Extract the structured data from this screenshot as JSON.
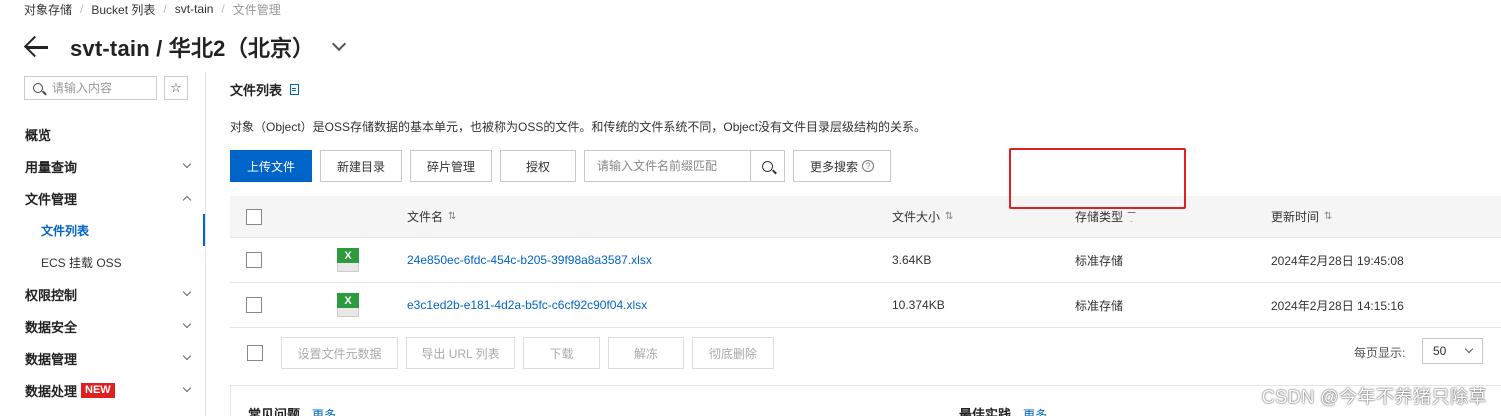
{
  "breadcrumb": [
    "对象存储",
    "Bucket 列表",
    "svt-tain",
    "文件管理"
  ],
  "header": {
    "bucket": "svt-tain",
    "separator": " / ",
    "region": "华北2（北京）"
  },
  "sidebar": {
    "search_placeholder": "请输入内容",
    "star": "☆",
    "items": [
      {
        "label": "概览"
      },
      {
        "label": "用量查询"
      },
      {
        "label": "文件管理"
      },
      {
        "label": "文件列表"
      },
      {
        "label": "ECS 挂载 OSS"
      },
      {
        "label": "权限控制"
      },
      {
        "label": "数据安全"
      },
      {
        "label": "数据管理"
      },
      {
        "label": "数据处理",
        "badge": "NEW"
      }
    ]
  },
  "main": {
    "title": "文件列表",
    "description": "对象（Object）是OSS存储数据的基本单元，也被称为OSS的文件。和传统的文件系统不同，Object没有文件目录层级结构的关系。",
    "toolbar": {
      "upload": "上传文件",
      "new_dir": "新建目录",
      "fragments": "碎片管理",
      "authorize": "授权",
      "search_placeholder": "请输入文件名前缀匹配",
      "more_search": "更多搜索",
      "help": "?"
    },
    "table": {
      "headers": {
        "name": "文件名",
        "size": "文件大小",
        "storage": "存储类型",
        "updated": "更新时间",
        "sort": "⇅"
      },
      "rows": [
        {
          "icon": "X",
          "name": "24e850ec-6fdc-454c-b205-39f98a8a3587.xlsx",
          "size": "3.64KB",
          "storage": "标准存储",
          "updated": "2024年2月28日 19:45:08"
        },
        {
          "icon": "X",
          "name": "e3c1ed2b-e181-4d2a-b5fc-c6cf92c90f04.xlsx",
          "size": "10.374KB",
          "storage": "标准存储",
          "updated": "2024年2月28日 14:15:16"
        }
      ]
    },
    "bulk_actions": [
      "设置文件元数据",
      "导出 URL 列表",
      "下载",
      "解冻",
      "彻底删除"
    ],
    "pagination": {
      "label": "每页显示:",
      "value": "50"
    },
    "faq": {
      "title": "常见问题",
      "more": "更多"
    },
    "best_practice": {
      "title": "最佳实践",
      "more": "更多"
    }
  },
  "watermark": "CSDN @今年不养猪只除草",
  "colors": {
    "primary": "#0064c8",
    "highlight": "#e02020",
    "excel": "#2e9a3e"
  }
}
